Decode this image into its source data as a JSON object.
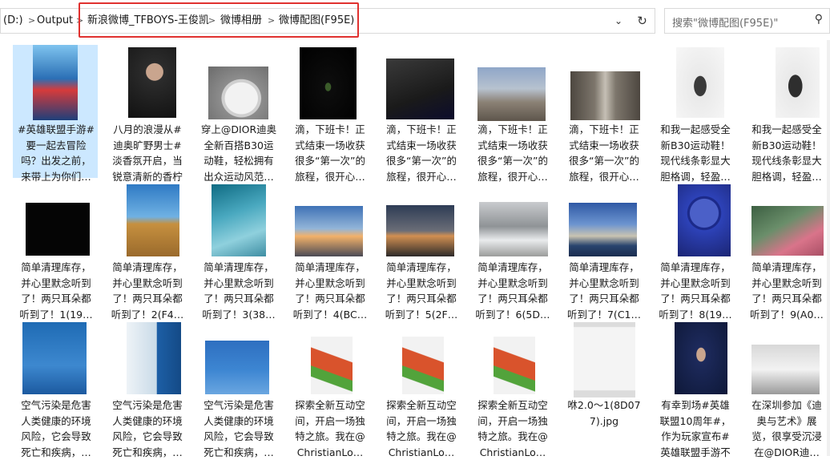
{
  "breadcrumb": {
    "drive": "(D:)",
    "items": [
      "Output",
      "新浪微博_TFBOYS-王俊凯",
      "微博相册",
      "微博配图(F95E)"
    ]
  },
  "search": {
    "placeholder": "搜索\"微博配图(F95E)\""
  },
  "colors": {
    "highlight": "#e0312f",
    "selection": "#cce8ff"
  },
  "files": [
    {
      "caption": "#英雄联盟手游#要一起去冒险吗？出发之前，来带上为你们…",
      "selected": true,
      "thumb": "poster-blue"
    },
    {
      "caption": "八月的浪漫从#迪奥旷野男士#淡香氛开启，当锐意清新的香柠檬…",
      "thumb": "portrait-dark"
    },
    {
      "caption": "穿上@DIOR迪奥全新百搭B30运动鞋，轻松拥有出众运动风范…",
      "thumb": "sneaker"
    },
    {
      "caption": "滴，下班卡！正式结束一场收获很多“第一次”的旅程，很开心…",
      "thumb": "night-sign"
    },
    {
      "caption": "滴，下班卡！正式结束一场收获很多“第一次”的旅程，很开心…",
      "thumb": "lanyard"
    },
    {
      "caption": "滴，下班卡！正式结束一场收获很多“第一次”的旅程，很开心…",
      "thumb": "wall"
    },
    {
      "caption": "滴，下班卡！正式结束一场收获很多“第一次”的旅程，很开心…",
      "thumb": "corridor"
    },
    {
      "caption": "和我一起感受全新B30运动鞋！现代线条彰显大胆格调，轻盈…",
      "thumb": "white-pose"
    },
    {
      "caption": "和我一起感受全新B30运动鞋！现代线条彰显大胆格调，轻盈…",
      "thumb": "white-pose2"
    },
    {
      "caption": "简单清理库存，并心里默念听到了！两只耳朵都听到了！1(19…",
      "thumb": "black"
    },
    {
      "caption": "简单清理库存，并心里默念听到了！两只耳朵都听到了！2(F4…",
      "thumb": "desert"
    },
    {
      "caption": "简单清理库存，并心里默念听到了！两只耳朵都听到了！3(38…",
      "thumb": "teal-arch"
    },
    {
      "caption": "简单清理库存，并心里默念听到了！两只耳朵都听到了！4(BC…",
      "thumb": "sunset-pier"
    },
    {
      "caption": "简单清理库存，并心里默念听到了！两只耳朵都听到了！5(2F…",
      "thumb": "dusk-city"
    },
    {
      "caption": "简单清理库存，并心里默念听到了！两只耳朵都听到了！6(5D…",
      "thumb": "snow"
    },
    {
      "caption": "简单清理库存，并心里默念听到了！两只耳朵都听到了！7(C1…",
      "thumb": "lake"
    },
    {
      "caption": "简单清理库存，并心里默念听到了！两只耳朵都听到了！8(19…",
      "thumb": "ferris"
    },
    {
      "caption": "简单清理库存，并心里默念听到了！两只耳朵都听到了！9(A0…",
      "thumb": "flowers"
    },
    {
      "caption": "空气污染是危害人类健康的环境风险，它会导致死亡和疾病，…",
      "thumb": "air-poster"
    },
    {
      "caption": "空气污染是危害人类健康的环境风险，它会导致死亡和疾病，…",
      "thumb": "leaf-doc"
    },
    {
      "caption": "空气污染是危害人类健康的环境风险，它会导致死亡和疾病，…",
      "thumb": "sky"
    },
    {
      "caption": "探索全新互动空间，开启一场独特之旅。我在@ChristianLo…",
      "thumb": "paint"
    },
    {
      "caption": "探索全新互动空间，开启一场独特之旅。我在@ChristianLo…",
      "thumb": "paint"
    },
    {
      "caption": "探索全新互动空间，开启一场独特之旅。我在@ChristianLo…",
      "thumb": "paint"
    },
    {
      "caption": "咻2.0～1(8D077).jpg",
      "thumb": "photo-frame"
    },
    {
      "caption": "有幸到场#英雄联盟10周年#，作为玩家宣布#英雄联盟手游不删…",
      "thumb": "gamer"
    },
    {
      "caption": "在深圳参加《迪奥与艺术》展览，很享受沉浸在@DIOR迪…",
      "thumb": "exhibit"
    }
  ]
}
